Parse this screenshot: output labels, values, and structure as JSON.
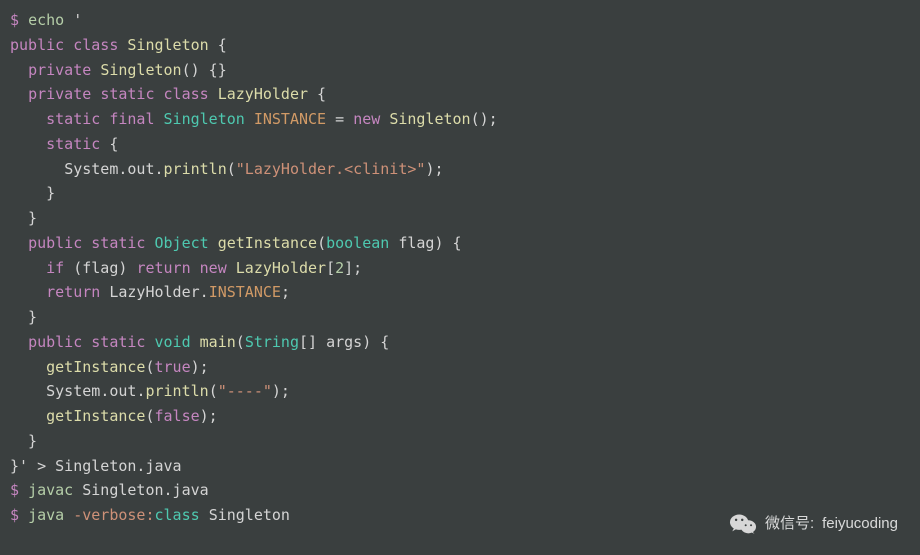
{
  "terminal": {
    "prompt": "$",
    "lines": [
      {
        "type": "cmd",
        "parts": [
          {
            "cls": "prompt",
            "t": "$ "
          },
          {
            "cls": "cmd-green",
            "t": "echo"
          },
          {
            "cls": "punct",
            "t": " '"
          }
        ]
      },
      {
        "type": "code",
        "parts": [
          {
            "cls": "kw",
            "t": "public"
          },
          {
            "cls": "punct",
            "t": " "
          },
          {
            "cls": "kw",
            "t": "class"
          },
          {
            "cls": "punct",
            "t": " "
          },
          {
            "cls": "class-name",
            "t": "Singleton"
          },
          {
            "cls": "punct",
            "t": " {"
          }
        ]
      },
      {
        "type": "code",
        "parts": [
          {
            "cls": "punct",
            "t": "  "
          },
          {
            "cls": "kw",
            "t": "private"
          },
          {
            "cls": "punct",
            "t": " "
          },
          {
            "cls": "class-name",
            "t": "Singleton"
          },
          {
            "cls": "punct",
            "t": "() {}"
          }
        ]
      },
      {
        "type": "code",
        "parts": [
          {
            "cls": "punct",
            "t": "  "
          },
          {
            "cls": "kw",
            "t": "private"
          },
          {
            "cls": "punct",
            "t": " "
          },
          {
            "cls": "kw",
            "t": "static"
          },
          {
            "cls": "punct",
            "t": " "
          },
          {
            "cls": "kw",
            "t": "class"
          },
          {
            "cls": "punct",
            "t": " "
          },
          {
            "cls": "class-name",
            "t": "LazyHolder"
          },
          {
            "cls": "punct",
            "t": " {"
          }
        ]
      },
      {
        "type": "code",
        "parts": [
          {
            "cls": "punct",
            "t": "    "
          },
          {
            "cls": "kw",
            "t": "static"
          },
          {
            "cls": "punct",
            "t": " "
          },
          {
            "cls": "kw",
            "t": "final"
          },
          {
            "cls": "punct",
            "t": " "
          },
          {
            "cls": "type",
            "t": "Singleton"
          },
          {
            "cls": "punct",
            "t": " "
          },
          {
            "cls": "const",
            "t": "INSTANCE"
          },
          {
            "cls": "punct",
            "t": " = "
          },
          {
            "cls": "kw",
            "t": "new"
          },
          {
            "cls": "punct",
            "t": " "
          },
          {
            "cls": "class-name",
            "t": "Singleton"
          },
          {
            "cls": "punct",
            "t": "();"
          }
        ]
      },
      {
        "type": "code",
        "parts": [
          {
            "cls": "punct",
            "t": "    "
          },
          {
            "cls": "kw",
            "t": "static"
          },
          {
            "cls": "punct",
            "t": " {"
          }
        ]
      },
      {
        "type": "code",
        "parts": [
          {
            "cls": "punct",
            "t": "      "
          },
          {
            "cls": "ident",
            "t": "System"
          },
          {
            "cls": "punct",
            "t": "."
          },
          {
            "cls": "ident",
            "t": "out"
          },
          {
            "cls": "punct",
            "t": "."
          },
          {
            "cls": "method",
            "t": "println"
          },
          {
            "cls": "punct",
            "t": "("
          },
          {
            "cls": "str",
            "t": "\"LazyHolder.<clinit>\""
          },
          {
            "cls": "punct",
            "t": ");"
          }
        ]
      },
      {
        "type": "code",
        "parts": [
          {
            "cls": "punct",
            "t": "    }"
          }
        ]
      },
      {
        "type": "code",
        "parts": [
          {
            "cls": "punct",
            "t": "  }"
          }
        ]
      },
      {
        "type": "code",
        "parts": [
          {
            "cls": "punct",
            "t": "  "
          },
          {
            "cls": "kw",
            "t": "public"
          },
          {
            "cls": "punct",
            "t": " "
          },
          {
            "cls": "kw",
            "t": "static"
          },
          {
            "cls": "punct",
            "t": " "
          },
          {
            "cls": "type",
            "t": "Object"
          },
          {
            "cls": "punct",
            "t": " "
          },
          {
            "cls": "method",
            "t": "getInstance"
          },
          {
            "cls": "punct",
            "t": "("
          },
          {
            "cls": "type",
            "t": "boolean"
          },
          {
            "cls": "punct",
            "t": " "
          },
          {
            "cls": "ident",
            "t": "flag"
          },
          {
            "cls": "punct",
            "t": ") {"
          }
        ]
      },
      {
        "type": "code",
        "parts": [
          {
            "cls": "punct",
            "t": "    "
          },
          {
            "cls": "kw",
            "t": "if"
          },
          {
            "cls": "punct",
            "t": " ("
          },
          {
            "cls": "ident",
            "t": "flag"
          },
          {
            "cls": "punct",
            "t": ") "
          },
          {
            "cls": "kw",
            "t": "return"
          },
          {
            "cls": "punct",
            "t": " "
          },
          {
            "cls": "kw",
            "t": "new"
          },
          {
            "cls": "punct",
            "t": " "
          },
          {
            "cls": "class-name",
            "t": "LazyHolder"
          },
          {
            "cls": "punct",
            "t": "["
          },
          {
            "cls": "num",
            "t": "2"
          },
          {
            "cls": "punct",
            "t": "];"
          }
        ]
      },
      {
        "type": "code",
        "parts": [
          {
            "cls": "punct",
            "t": "    "
          },
          {
            "cls": "kw",
            "t": "return"
          },
          {
            "cls": "punct",
            "t": " "
          },
          {
            "cls": "ident",
            "t": "LazyHolder"
          },
          {
            "cls": "punct",
            "t": "."
          },
          {
            "cls": "const",
            "t": "INSTANCE"
          },
          {
            "cls": "punct",
            "t": ";"
          }
        ]
      },
      {
        "type": "code",
        "parts": [
          {
            "cls": "punct",
            "t": "  }"
          }
        ]
      },
      {
        "type": "code",
        "parts": [
          {
            "cls": "punct",
            "t": "  "
          },
          {
            "cls": "kw",
            "t": "public"
          },
          {
            "cls": "punct",
            "t": " "
          },
          {
            "cls": "kw",
            "t": "static"
          },
          {
            "cls": "punct",
            "t": " "
          },
          {
            "cls": "type",
            "t": "void"
          },
          {
            "cls": "punct",
            "t": " "
          },
          {
            "cls": "method",
            "t": "main"
          },
          {
            "cls": "punct",
            "t": "("
          },
          {
            "cls": "type",
            "t": "String"
          },
          {
            "cls": "punct",
            "t": "[] "
          },
          {
            "cls": "ident",
            "t": "args"
          },
          {
            "cls": "punct",
            "t": ") {"
          }
        ]
      },
      {
        "type": "code",
        "parts": [
          {
            "cls": "punct",
            "t": "    "
          },
          {
            "cls": "method",
            "t": "getInstance"
          },
          {
            "cls": "punct",
            "t": "("
          },
          {
            "cls": "bool",
            "t": "true"
          },
          {
            "cls": "punct",
            "t": ");"
          }
        ]
      },
      {
        "type": "code",
        "parts": [
          {
            "cls": "punct",
            "t": "    "
          },
          {
            "cls": "ident",
            "t": "System"
          },
          {
            "cls": "punct",
            "t": "."
          },
          {
            "cls": "ident",
            "t": "out"
          },
          {
            "cls": "punct",
            "t": "."
          },
          {
            "cls": "method",
            "t": "println"
          },
          {
            "cls": "punct",
            "t": "("
          },
          {
            "cls": "str",
            "t": "\"----\""
          },
          {
            "cls": "punct",
            "t": ");"
          }
        ]
      },
      {
        "type": "code",
        "parts": [
          {
            "cls": "punct",
            "t": "    "
          },
          {
            "cls": "method",
            "t": "getInstance"
          },
          {
            "cls": "punct",
            "t": "("
          },
          {
            "cls": "bool",
            "t": "false"
          },
          {
            "cls": "punct",
            "t": ");"
          }
        ]
      },
      {
        "type": "code",
        "parts": [
          {
            "cls": "punct",
            "t": "  }"
          }
        ]
      },
      {
        "type": "code",
        "parts": [
          {
            "cls": "punct",
            "t": "}' "
          },
          {
            "cls": "redir",
            "t": "> "
          },
          {
            "cls": "file",
            "t": "Singleton.java"
          }
        ]
      },
      {
        "type": "cmd",
        "parts": [
          {
            "cls": "prompt",
            "t": "$ "
          },
          {
            "cls": "cmd-green",
            "t": "javac"
          },
          {
            "cls": "punct",
            "t": " "
          },
          {
            "cls": "file",
            "t": "Singleton.java"
          }
        ]
      },
      {
        "type": "cmd",
        "parts": [
          {
            "cls": "prompt",
            "t": "$ "
          },
          {
            "cls": "cmd-green",
            "t": "java"
          },
          {
            "cls": "punct",
            "t": " "
          },
          {
            "cls": "cmd-orange",
            "t": "-verbose:"
          },
          {
            "cls": "cmd-cyan",
            "t": "class"
          },
          {
            "cls": "punct",
            "t": " "
          },
          {
            "cls": "file",
            "t": "Singleton"
          }
        ]
      }
    ]
  },
  "watermark": {
    "label": "微信号:",
    "value": "feiyucoding"
  }
}
